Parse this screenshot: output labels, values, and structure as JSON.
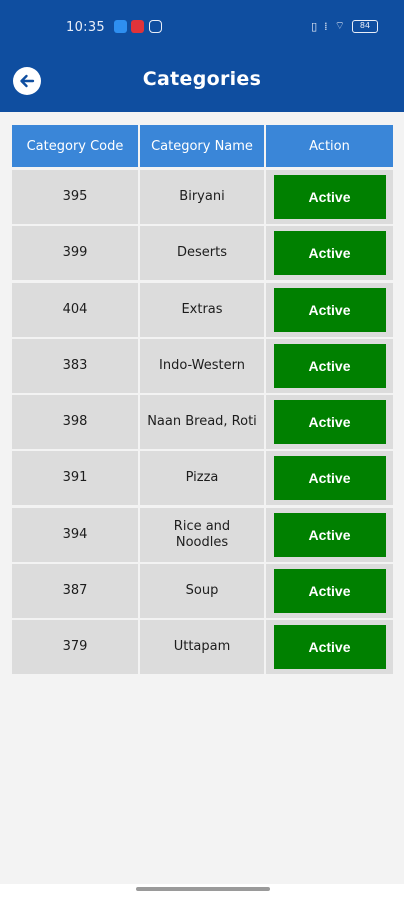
{
  "status_bar": {
    "time": "10:35",
    "battery": "84"
  },
  "header": {
    "title": "Categories"
  },
  "table": {
    "columns": [
      "Category Code",
      "Category Name",
      "Action"
    ],
    "rows": [
      {
        "code": "395",
        "name": "Biryani",
        "action": "Active"
      },
      {
        "code": "399",
        "name": "Deserts",
        "action": "Active"
      },
      {
        "code": "404",
        "name": "Extras",
        "action": "Active"
      },
      {
        "code": "383",
        "name": "Indo-Western",
        "action": "Active"
      },
      {
        "code": "398",
        "name": "Naan Bread, Roti",
        "action": "Active"
      },
      {
        "code": "391",
        "name": "Pizza",
        "action": "Active"
      },
      {
        "code": "394",
        "name": "Rice  and Noodles",
        "action": "Active"
      },
      {
        "code": "387",
        "name": "Soup",
        "action": "Active"
      },
      {
        "code": "379",
        "name": "Uttapam",
        "action": "Active"
      }
    ]
  },
  "colors": {
    "appbar": "#0f4ea0",
    "header_cell": "#3a86d8",
    "row_cell": "#dcdcdc",
    "active_button": "#008000"
  }
}
